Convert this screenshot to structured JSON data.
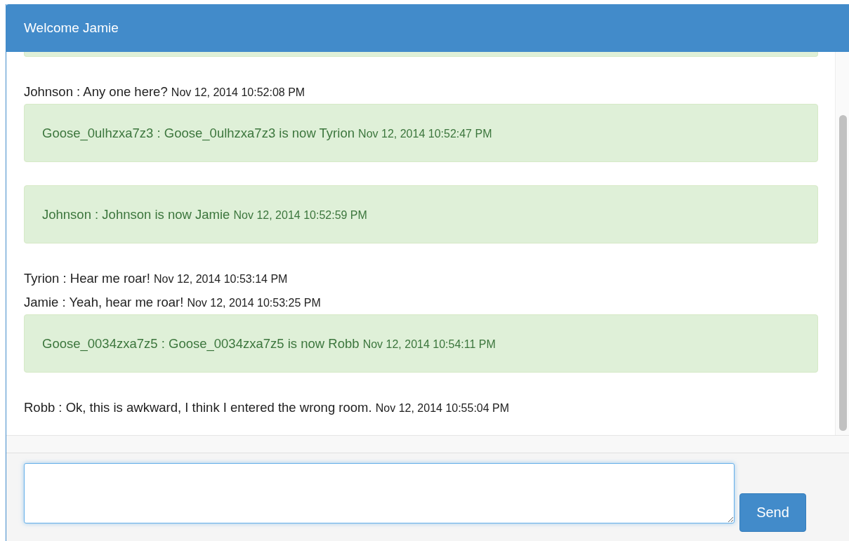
{
  "header": {
    "title": "Welcome Jamie"
  },
  "messages": [
    {
      "kind": "chat",
      "text": "Johnson : Any one here?",
      "time": "Nov 12, 2014 10:52:08 PM"
    },
    {
      "kind": "notice",
      "text": "Goose_0ulhzxa7z3 : Goose_0ulhzxa7z3 is now Tyrion",
      "time": "Nov 12, 2014 10:52:47 PM"
    },
    {
      "kind": "notice",
      "text": "Johnson : Johnson is now Jamie",
      "time": "Nov 12, 2014 10:52:59 PM"
    },
    {
      "kind": "chat",
      "text": "Tyrion : Hear me roar!",
      "time": "Nov 12, 2014 10:53:14 PM"
    },
    {
      "kind": "chat",
      "text": "Jamie : Yeah, hear me roar!",
      "time": "Nov 12, 2014 10:53:25 PM"
    },
    {
      "kind": "notice",
      "text": "Goose_0034zxa7z5 : Goose_0034zxa7z5 is now Robb",
      "time": "Nov 12, 2014 10:54:11 PM"
    },
    {
      "kind": "chat",
      "text": "Robb : Ok, this is awkward, I think I entered the wrong room.",
      "time": "Nov 12, 2014 10:55:04 PM"
    }
  ],
  "composer": {
    "button": "Send"
  }
}
